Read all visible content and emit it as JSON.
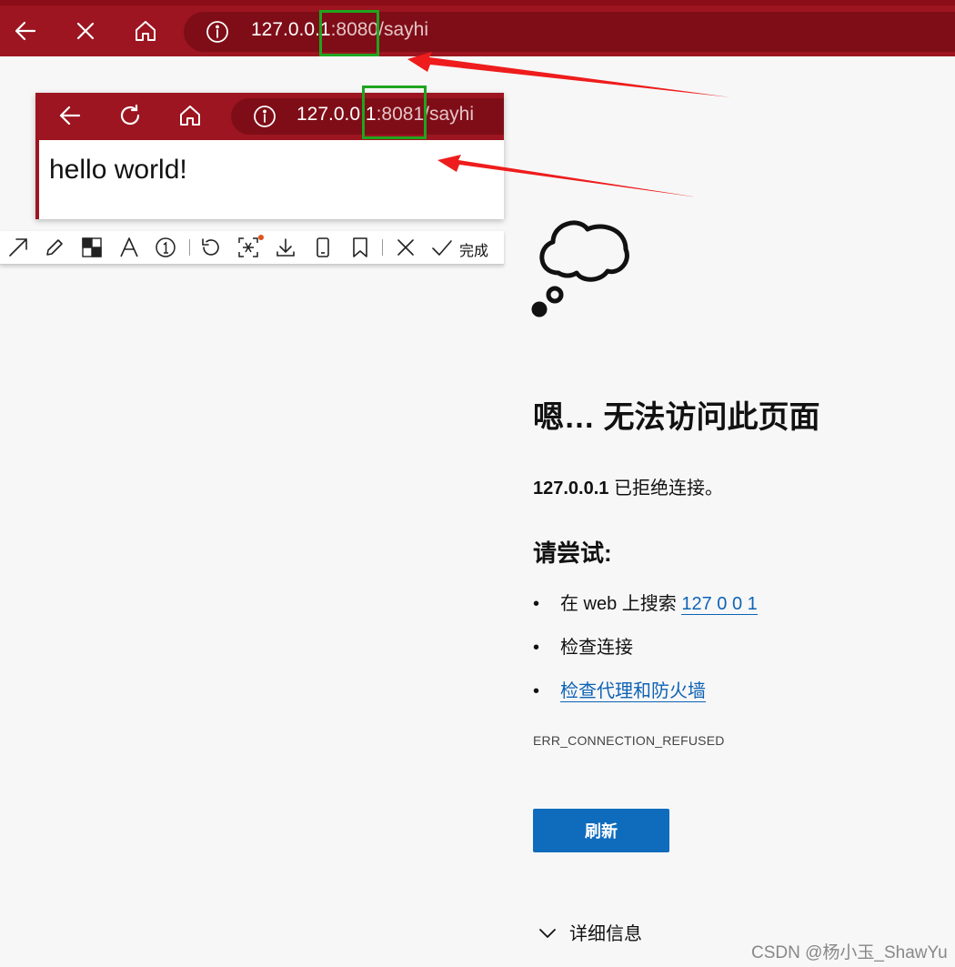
{
  "main_browser": {
    "url_host": "127.0.0.1",
    "url_port": ":8080",
    "url_path": "/sayhi"
  },
  "inset_browser": {
    "url_host": "127.0.0.1",
    "url_port": ":8081",
    "url_path": "/sayhi",
    "content": "hello world!"
  },
  "annotation_toolbar": {
    "tools": [
      "arrow-icon",
      "pencil-icon",
      "mosaic-icon",
      "text-icon",
      "number-icon",
      "undo-icon",
      "ocr-icon",
      "download-icon",
      "pin-icon",
      "bookmark-icon",
      "close-icon",
      "check-icon"
    ],
    "done_label": "完成"
  },
  "error_page": {
    "title": "嗯… 无法访问此页面",
    "host": "127.0.0.1",
    "message": " 已拒绝连接。",
    "try_title": "请尝试:",
    "suggestions": {
      "s1_prefix": "在 web 上搜索 ",
      "s1_link": "127 0 0 1",
      "s2": "检查连接",
      "s3_link": "检查代理和防火墙"
    },
    "error_code": "ERR_CONNECTION_REFUSED",
    "refresh_label": "刷新",
    "details_label": "详细信息"
  },
  "watermark": "CSDN @杨小玉_ShawYu",
  "colors": {
    "toolbar_red": "#9c1520",
    "url_red": "#7f0d17",
    "highlight_green": "#1fa51f",
    "arrow_red": "#ee1c1c",
    "link_blue": "#0e63b5",
    "button_blue": "#0f6cbd"
  }
}
